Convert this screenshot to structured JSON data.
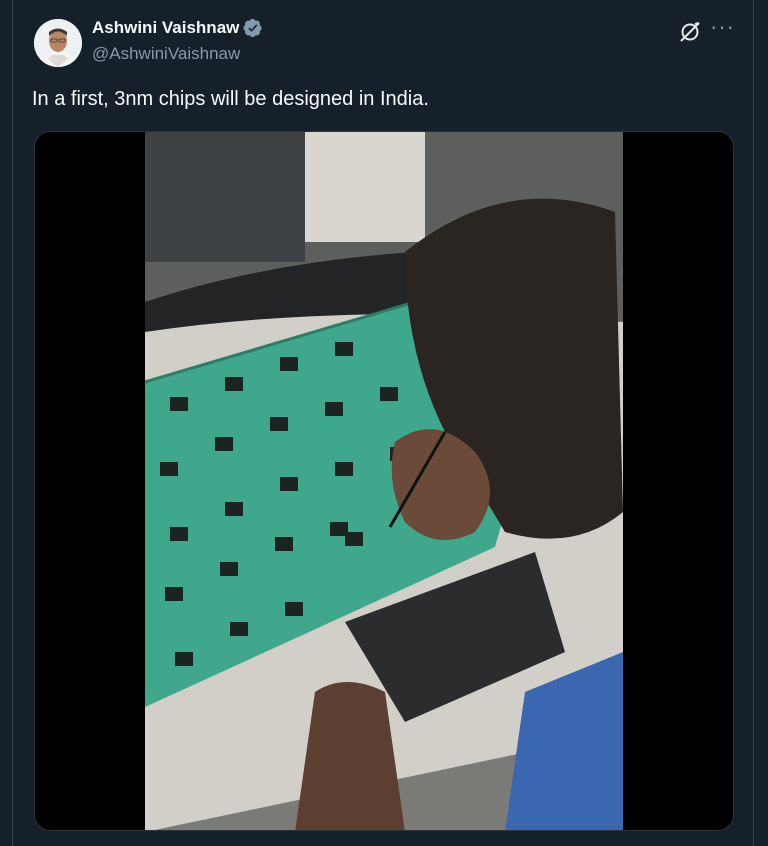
{
  "author": {
    "display_name": "Ashwini Vaishnaw",
    "handle": "@AshwiniVaishnaw",
    "verified": true
  },
  "tweet": {
    "text": "In a first, 3nm chips will be designed in India."
  },
  "icons": {
    "verified": "verified-badge-icon",
    "grok": "grok-icon",
    "more": "more-icon"
  },
  "colors": {
    "background": "#15202b",
    "secondary_text": "#8b98a5",
    "verified_badge": "#829aab",
    "pcb": "#3fa88c"
  }
}
